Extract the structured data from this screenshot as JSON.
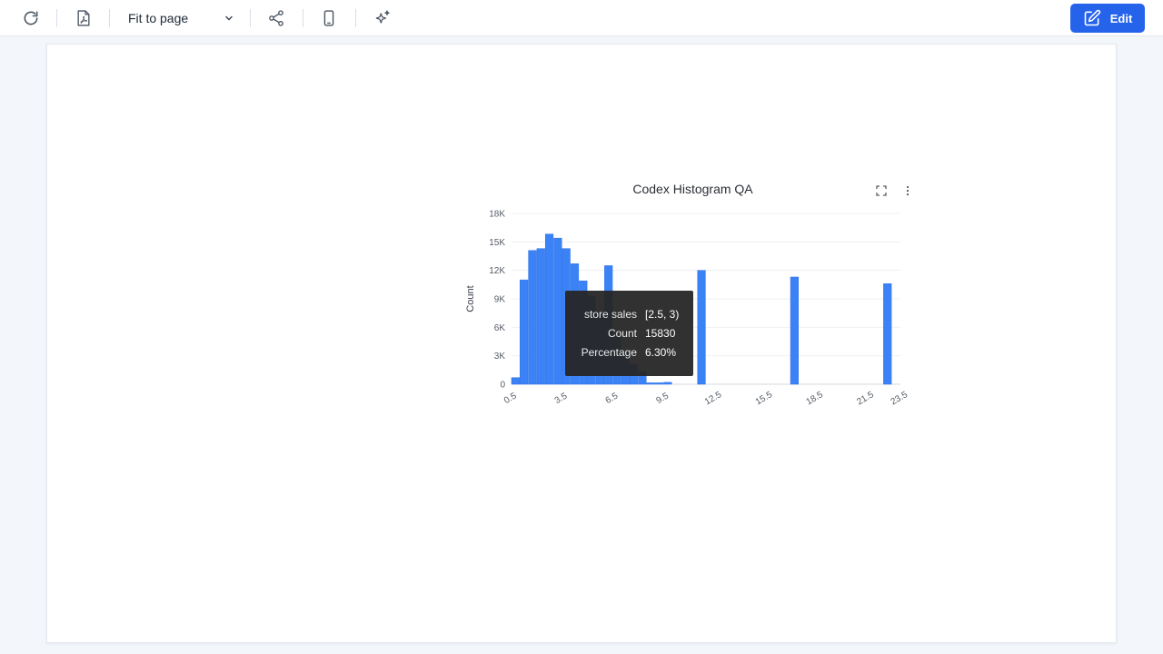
{
  "toolbar": {
    "zoom": {
      "selected": "Fit to page"
    },
    "edit_label": "Edit"
  },
  "icons": {
    "refresh": "refresh-icon",
    "pdf": "pdf-file-icon",
    "share": "share-icon",
    "mobile": "mobile-device-icon",
    "ai": "sparkle-icon",
    "edit": "edit-pencil-icon",
    "fullscreen": "fullscreen-icon",
    "more": "more-vertical-icon"
  },
  "colors": {
    "accent": "#2563eb",
    "bar": "#3b82f6",
    "bar_edge": "#2f72e6"
  },
  "chart_data": {
    "type": "bar",
    "title": "Codex Histogram QA",
    "xlabel": "",
    "ylabel": "Count",
    "bin_width": 0.5,
    "xlim": [
      0.5,
      23.5
    ],
    "ylim": [
      0,
      18000
    ],
    "x_ticks": [
      "0.5",
      "3.5",
      "6.5",
      "9.5",
      "12.5",
      "15.5",
      "18.5",
      "21.5",
      "23.5"
    ],
    "y_ticks": [
      "0",
      "3K",
      "6K",
      "9K",
      "12K",
      "15K",
      "18K"
    ],
    "grid": true,
    "bins": [
      {
        "x0": 0.5,
        "count": 700
      },
      {
        "x0": 1.0,
        "count": 11000
      },
      {
        "x0": 1.5,
        "count": 14100
      },
      {
        "x0": 2.0,
        "count": 14300
      },
      {
        "x0": 2.5,
        "count": 15830
      },
      {
        "x0": 3.0,
        "count": 15400
      },
      {
        "x0": 3.5,
        "count": 14300
      },
      {
        "x0": 4.0,
        "count": 12700
      },
      {
        "x0": 4.5,
        "count": 10900
      },
      {
        "x0": 5.0,
        "count": 9300
      },
      {
        "x0": 5.5,
        "count": 7600
      },
      {
        "x0": 6.0,
        "count": 12500
      },
      {
        "x0": 6.5,
        "count": 5200
      },
      {
        "x0": 7.0,
        "count": 3500
      },
      {
        "x0": 7.5,
        "count": 2100
      },
      {
        "x0": 8.0,
        "count": 1300
      },
      {
        "x0": 8.5,
        "count": 150
      },
      {
        "x0": 9.0,
        "count": 150
      },
      {
        "x0": 9.5,
        "count": 200
      },
      {
        "x0": 11.5,
        "count": 12000
      },
      {
        "x0": 17.0,
        "count": 11300
      },
      {
        "x0": 22.5,
        "count": 10600
      }
    ],
    "tooltip": {
      "rows": [
        {
          "label": "store sales",
          "value": "[2.5, 3)"
        },
        {
          "label": "Count",
          "value": "15830"
        },
        {
          "label": "Percentage",
          "value": "6.30%"
        }
      ]
    }
  }
}
